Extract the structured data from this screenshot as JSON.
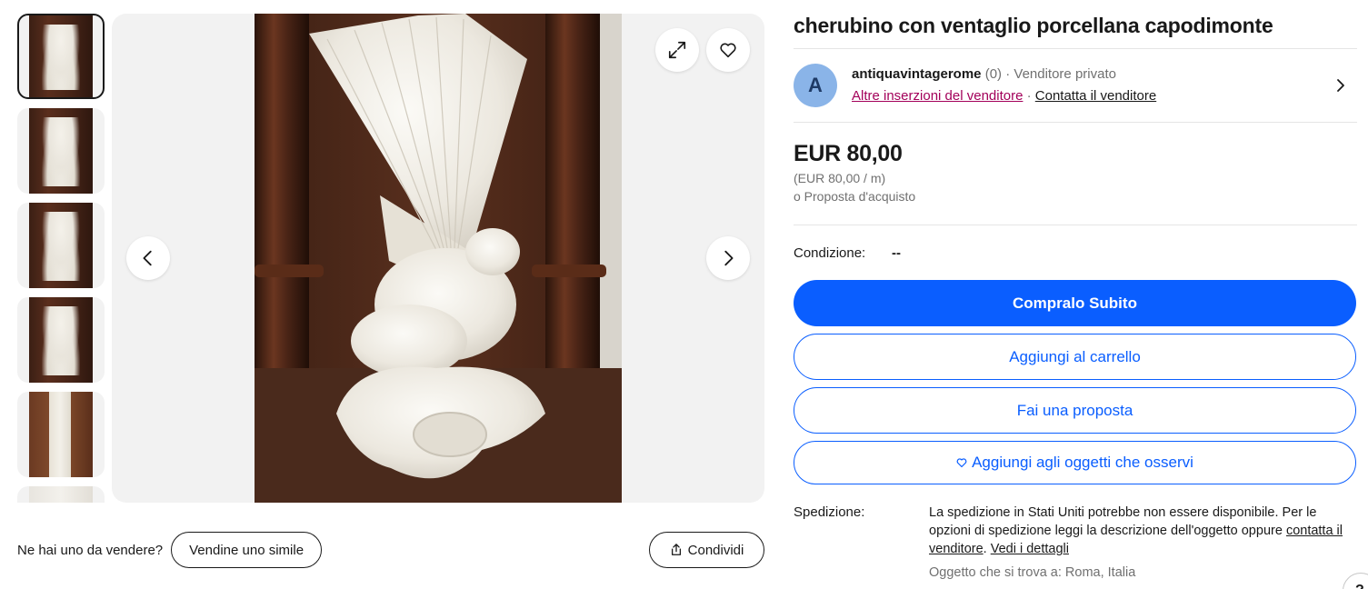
{
  "gallery": {
    "thumbnails": [
      {
        "label": "thumbnail-1"
      },
      {
        "label": "thumbnail-2"
      },
      {
        "label": "thumbnail-3"
      },
      {
        "label": "thumbnail-4"
      },
      {
        "label": "thumbnail-5"
      },
      {
        "label": "thumbnail-6"
      }
    ],
    "icons": {
      "prev": "chevron-left-icon",
      "next": "chevron-right-icon",
      "expand": "expand-icon",
      "watch": "heart-icon"
    }
  },
  "sell": {
    "prompt": "Ne hai uno da vendere?",
    "button": "Vendine uno simile"
  },
  "share": {
    "label": "Condividi"
  },
  "item": {
    "title": "cherubino con ventaglio porcellana capodimonte"
  },
  "seller": {
    "avatar_letter": "A",
    "name": "antiquavintagerome",
    "feedback": "(0)",
    "separator": "·",
    "type": "Venditore privato",
    "other_listings": "Altre inserzioni del venditore",
    "contact": "Contatta il venditore"
  },
  "price": {
    "main": "EUR 80,00",
    "unit": "(EUR 80,00 / m)",
    "offer": "o Proposta d'acquisto"
  },
  "condition": {
    "label": "Condizione:",
    "value": "--"
  },
  "actions": {
    "buy_now": "Compralo Subito",
    "add_cart": "Aggiungi al carrello",
    "make_offer": "Fai una proposta",
    "watch": "Aggiungi agli oggetti che osservi"
  },
  "shipping": {
    "label": "Spedizione:",
    "text": "La spedizione in Stati Uniti potrebbe non essere disponibile. Per le opzioni di spedizione leggi la descrizione dell'oggetto oppure",
    "contact_link": "contatta il venditore",
    "period": ".",
    "details_link": "Vedi i dettagli",
    "location": "Oggetto che si trova a: Roma, Italia"
  },
  "help": {
    "label": "?"
  },
  "colors": {
    "accent": "#0a5eff",
    "link_purple": "#a3005a",
    "text": "#191919",
    "muted": "#707070"
  }
}
